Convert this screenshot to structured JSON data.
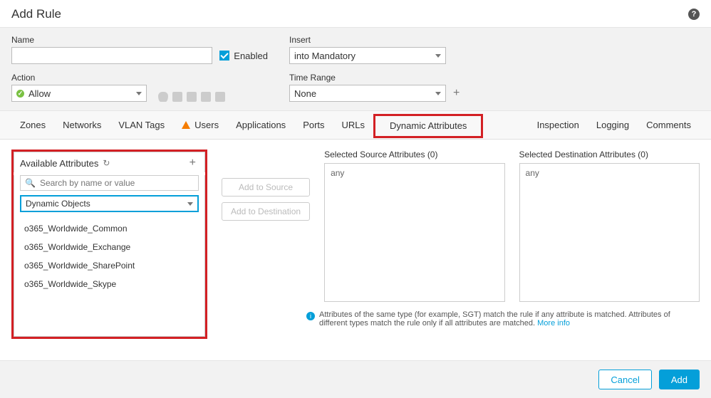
{
  "dialog_title": "Add Rule",
  "form": {
    "name_label": "Name",
    "name_value": "",
    "enabled_label": "Enabled",
    "action_label": "Action",
    "action_value": "Allow",
    "insert_label": "Insert",
    "insert_value": "into Mandatory",
    "timerange_label": "Time Range",
    "timerange_value": "None"
  },
  "tabs": {
    "items": [
      "Zones",
      "Networks",
      "VLAN Tags",
      "Users",
      "Applications",
      "Ports",
      "URLs",
      "Dynamic Attributes"
    ],
    "right_items": [
      "Inspection",
      "Logging",
      "Comments"
    ],
    "active": "Dynamic Attributes"
  },
  "available": {
    "title": "Available Attributes",
    "search_placeholder": "Search by name or value",
    "filter_value": "Dynamic Objects",
    "items": [
      "o365_Worldwide_Common",
      "o365_Worldwide_Exchange",
      "o365_Worldwide_SharePoint",
      "o365_Worldwide_Skype"
    ]
  },
  "mid_buttons": {
    "add_source": "Add to Source",
    "add_destination": "Add to Destination"
  },
  "source_panel": {
    "title": "Selected Source Attributes (0)",
    "placeholder": "any"
  },
  "dest_panel": {
    "title": "Selected Destination Attributes (0)",
    "placeholder": "any"
  },
  "hint_text": "Attributes of the same type (for example, SGT) match the rule if any attribute is matched. Attributes of different types match the rule only if all attributes are matched.",
  "hint_link": "More info",
  "footer": {
    "cancel": "Cancel",
    "add": "Add"
  }
}
